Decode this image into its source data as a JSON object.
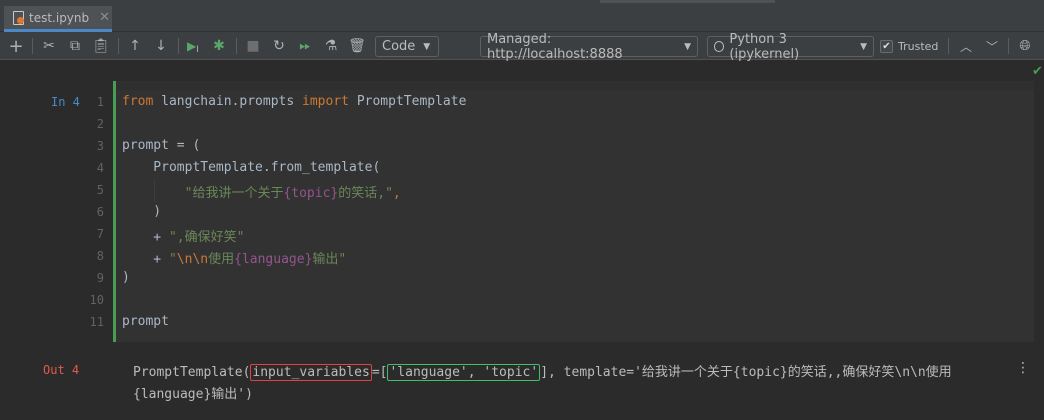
{
  "tab": {
    "filename": "test.ipynb",
    "close_glyph": "✕"
  },
  "toolbar": {
    "kernel_type": "Code",
    "server": "Managed: http://localhost:8888",
    "kernel": "Python 3 (ipykernel)",
    "trusted_label": "Trusted",
    "icons": [
      "add-cell-icon",
      "cut-icon",
      "copy-icon",
      "paste-icon",
      "move-up-icon",
      "move-down-icon",
      "run-cell-icon",
      "debug-icon",
      "stop-icon",
      "restart-icon",
      "run-all-icon",
      "clear-icon",
      "delete-icon",
      "collapse-up-icon",
      "collapse-down-icon",
      "browser-icon"
    ]
  },
  "cell": {
    "in_prompt": "In 4",
    "out_prompt": "Out 4",
    "line_numbers": [
      "1",
      "2",
      "3",
      "4",
      "5",
      "6",
      "7",
      "8",
      "9",
      "10",
      "11"
    ],
    "code": {
      "l1_from": "from",
      "l1_mod": " langchain.prompts ",
      "l1_import": "import",
      "l1_name": " PromptTemplate",
      "l3": "prompt = (",
      "l4": "    PromptTemplate.from_template(",
      "l5_indent": "        ",
      "l5_s1": "\"给我讲一个关于",
      "l5_f": "{topic}",
      "l5_s2": "的笑话,\"",
      "l5_comma": ",",
      "l6": "    )",
      "l7_plus": "    + ",
      "l7_str": "\",确保好笑\"",
      "l8_plus": "    + ",
      "l8_q": "\"",
      "l8_esc": "\\n\\n",
      "l8_s1": "使用",
      "l8_f": "{language}",
      "l8_s2": "输出\"",
      "l9": ")",
      "l11": "prompt"
    },
    "output": {
      "p1": "PromptTemplate(",
      "boxed1": "input_variables",
      "p2": "=[",
      "boxed2": "'language', 'topic'",
      "p3": "], template='给我讲一个关于{topic}的笑话,,确保好笑\\n\\n使用",
      "line2": "{language}输出')"
    }
  },
  "colors": {
    "keyword": "#cc7832",
    "string": "#6a8759",
    "field": "#94558d",
    "accent_green": "#499c54",
    "box_red": "#e0424a",
    "box_green": "#3fbf6a"
  }
}
